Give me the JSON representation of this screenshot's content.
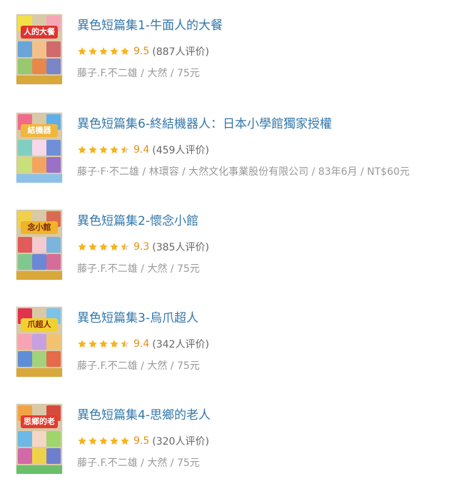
{
  "colors": {
    "title": "#3377aa",
    "score": "#e09015",
    "meta": "#999999",
    "star_fill": "#f5b31d",
    "star_empty": "#dcdcdc"
  },
  "books": [
    {
      "title": "異色短篇集1-牛面人的大餐",
      "rating": 9.5,
      "stars": 5,
      "score_text": "9.5",
      "count_text": "(887人评价)",
      "pub": "藤子.F.不二雄 / 大然 / 75元",
      "cover_banner": "人的大餐"
    },
    {
      "title": "異色短篇集6-終結機器人：日本小學館獨家授權",
      "rating": 9.4,
      "stars": 4.5,
      "score_text": "9.4",
      "count_text": "(459人评价)",
      "pub": "藤子·F·不二雄 / 林環容 / 大然文化事業股份有限公司 / 83年6月 / NT$60元",
      "cover_banner": "結機器"
    },
    {
      "title": "異色短篇集2-懷念小館",
      "rating": 9.3,
      "stars": 4.5,
      "score_text": "9.3",
      "count_text": "(385人评价)",
      "pub": "藤子.F.不二雄 / 大然 / 75元",
      "cover_banner": "念小館"
    },
    {
      "title": "異色短篇集3-烏爪超人",
      "rating": 9.4,
      "stars": 4.5,
      "score_text": "9.4",
      "count_text": "(342人评价)",
      "pub": "藤子.F.不二雄 / 大然 / 75元",
      "cover_banner": "爪超人"
    },
    {
      "title": "異色短篇集4-思鄉的老人",
      "rating": 9.5,
      "stars": 5,
      "score_text": "9.5",
      "count_text": "(320人评价)",
      "pub": "藤子.F.不二雄 / 大然 / 75元",
      "cover_banner": "思鄉的老"
    }
  ]
}
